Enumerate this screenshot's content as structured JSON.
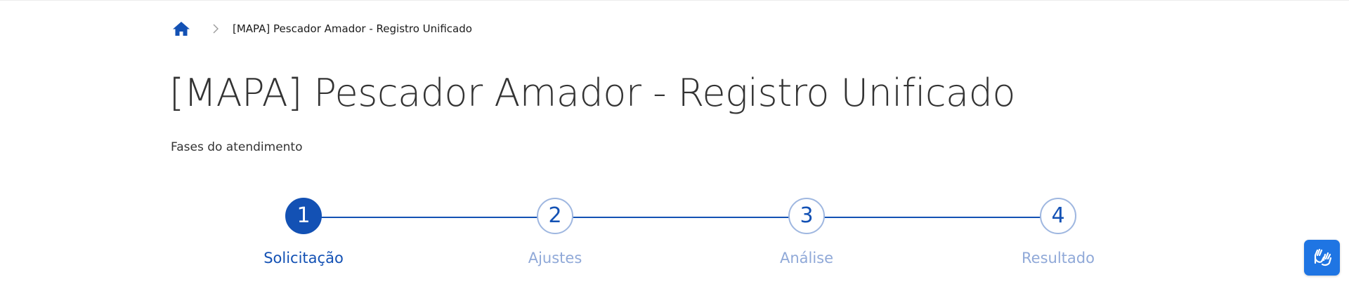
{
  "breadcrumb": {
    "home_icon": "home-icon",
    "separator_icon": "chevron-right-icon",
    "current": "[MAPA] Pescador Amador - Registro Unificado"
  },
  "page": {
    "title": "[MAPA] Pescador Amador - Registro Unificado",
    "phases_label": "Fases do atendimento"
  },
  "stepper": {
    "active_step": 1,
    "steps": [
      {
        "number": "1",
        "label": "Solicitação"
      },
      {
        "number": "2",
        "label": "Ajustes"
      },
      {
        "number": "3",
        "label": "Análise"
      },
      {
        "number": "4",
        "label": "Resultado"
      }
    ]
  },
  "accessibility": {
    "vlibras_icon": "hands-sign-language-icon"
  },
  "colors": {
    "primary": "#1351b4",
    "inactive_label": "#90a9d8",
    "vlibras_bg": "#1f75e3",
    "text": "#333333"
  }
}
